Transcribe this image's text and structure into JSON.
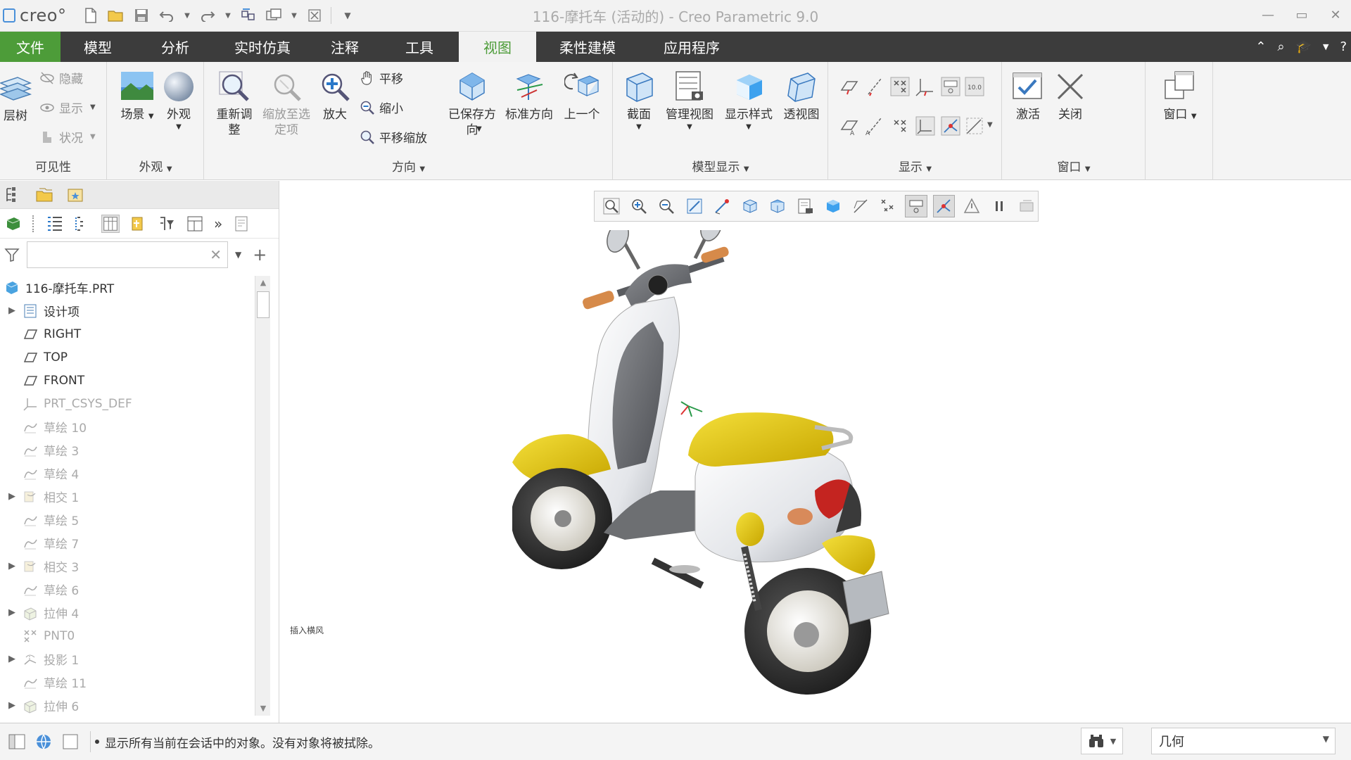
{
  "window": {
    "title": "116-摩托车 (活动的) - Creo Parametric 9.0",
    "logo": "creo°"
  },
  "tabs": [
    {
      "label": "文件"
    },
    {
      "label": "模型"
    },
    {
      "label": "分析"
    },
    {
      "label": "实时仿真"
    },
    {
      "label": "注释"
    },
    {
      "label": "工具"
    },
    {
      "label": "视图"
    },
    {
      "label": "柔性建模"
    },
    {
      "label": "应用程序"
    }
  ],
  "ribbon": {
    "visibility": {
      "label": "可见性",
      "layer_tree": "层树",
      "hide": "隐藏",
      "show": "显示",
      "status": "状况"
    },
    "appearance": {
      "label": "外观",
      "scene": "场景",
      "appearance": "外观"
    },
    "orientation": {
      "label": "方向",
      "refit": "重新调\n整",
      "zoom_to_selected": "缩放至选\n定项",
      "zoom_in": "放大",
      "pan": "平移",
      "zoom_out": "缩小",
      "pan_zoom": "平移缩放",
      "saved_orientations": "已保存方\n向",
      "standard_orientation": "标准方向",
      "previous": "上一个"
    },
    "model_display": {
      "label": "模型显示",
      "section": "截面",
      "manage_views": "管理视图",
      "display_style": "显示样式",
      "perspective": "透视图"
    },
    "show": {
      "label": "显示"
    },
    "window": {
      "label": "窗口",
      "activate": "激活",
      "close": "关闭",
      "windows": "窗口"
    }
  },
  "tree": {
    "items": [
      {
        "label": "116-摩托车.PRT"
      },
      {
        "label": "设计项"
      },
      {
        "label": "RIGHT"
      },
      {
        "label": "TOP"
      },
      {
        "label": "FRONT"
      },
      {
        "label": "PRT_CSYS_DEF"
      },
      {
        "label": "草绘 10"
      },
      {
        "label": "草绘 3"
      },
      {
        "label": "草绘 4"
      },
      {
        "label": "相交 1"
      },
      {
        "label": "草绘 5"
      },
      {
        "label": "草绘 7"
      },
      {
        "label": "相交 3"
      },
      {
        "label": "草绘 6"
      },
      {
        "label": "拉伸 4"
      },
      {
        "label": "PNT0"
      },
      {
        "label": "投影 1"
      },
      {
        "label": "草绘 11"
      },
      {
        "label": "拉伸 6"
      }
    ]
  },
  "graphics": {
    "note": "插入横风"
  },
  "status": {
    "message": "显示所有当前在会话中的对象。没有对象将被拭除。",
    "filter_value": "几何"
  },
  "colors": {
    "file_tab": "#4d9c39",
    "tab_bar": "#3c3c3c",
    "scooter_yellow": "#e2c000",
    "scooter_gray": "#6d6f72"
  }
}
